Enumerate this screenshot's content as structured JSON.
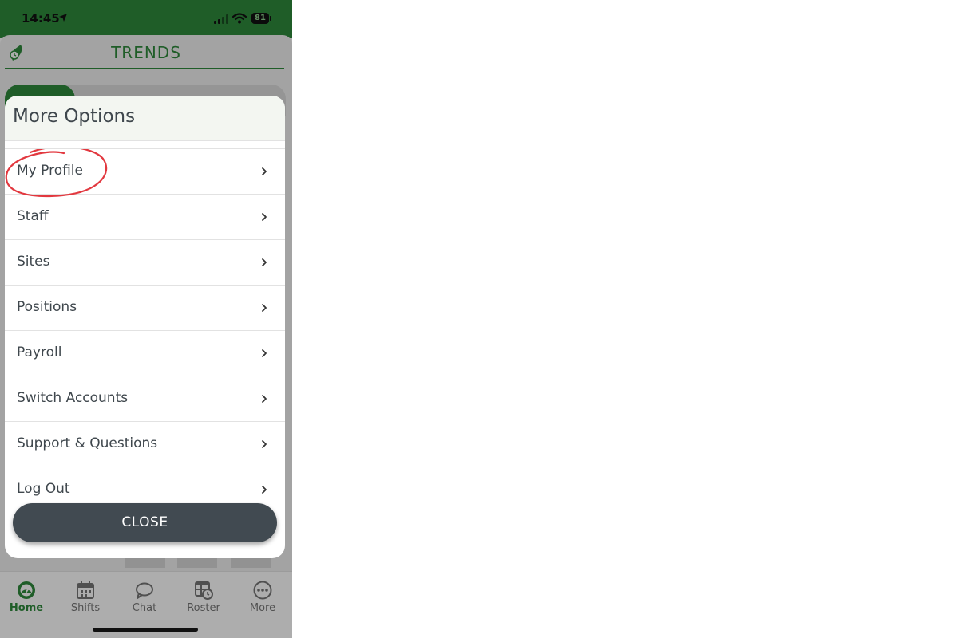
{
  "status_bar": {
    "time": "14:45",
    "battery": "81"
  },
  "app": {
    "title": "TRENDS"
  },
  "modal": {
    "title": "More Options",
    "items": [
      {
        "label": "My Profile"
      },
      {
        "label": "Staff"
      },
      {
        "label": "Sites"
      },
      {
        "label": "Positions"
      },
      {
        "label": "Payroll"
      },
      {
        "label": "Switch Accounts"
      },
      {
        "label": "Support & Questions"
      },
      {
        "label": "Log Out"
      }
    ],
    "close_label": "CLOSE"
  },
  "tab_bar": {
    "tabs": [
      {
        "label": "Home",
        "icon": "dashboard-gauge-icon"
      },
      {
        "label": "Shifts",
        "icon": "calendar-icon"
      },
      {
        "label": "Chat",
        "icon": "chat-bubble-icon"
      },
      {
        "label": "Roster",
        "icon": "roster-clock-icon"
      },
      {
        "label": "More",
        "icon": "more-dots-icon"
      }
    ]
  },
  "colors": {
    "brand_green": "#2f8a3c",
    "button_dark": "#414a51",
    "text_dark": "#3f474d",
    "annotation_red": "#e2383f"
  }
}
